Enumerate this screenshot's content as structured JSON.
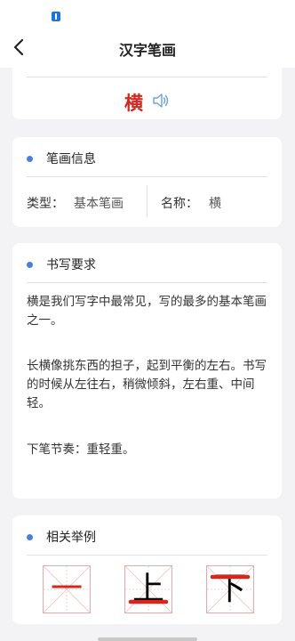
{
  "header": {
    "title": "汉字笔画"
  },
  "stroke": {
    "char": "横"
  },
  "info": {
    "section_title": "笔画信息",
    "type_label": "类型：",
    "type_value": "基本笔画",
    "name_label": "名称：",
    "name_value": "横"
  },
  "writing": {
    "section_title": "书写要求",
    "paragraphs": [
      "横是我们写字中最常见，写的最多的基本笔画之一。",
      "长横像挑东西的担子，起到平衡的左右。书写的时候从左往右，稍微倾斜，左右重、中间轻。",
      "下笔节奏：重轻重。"
    ]
  },
  "examples": {
    "section_title": "相关举例",
    "chars": [
      "一",
      "上",
      "下"
    ]
  },
  "colors": {
    "accent": "#4a7de0",
    "stroke_red": "#d9261c"
  }
}
